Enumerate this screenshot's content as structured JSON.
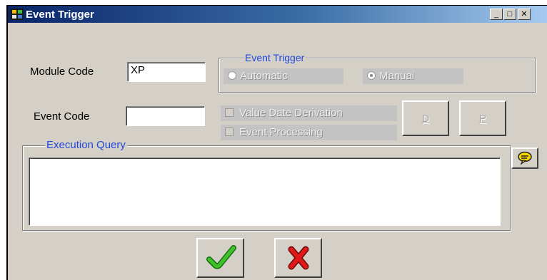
{
  "window": {
    "title": "Event Trigger",
    "controls": {
      "minimize": "_",
      "maximize": "□",
      "close": "✕"
    }
  },
  "form": {
    "module_code_label": "Module Code",
    "module_code_value": "XP",
    "event_code_label": "Event Code",
    "event_code_value": ""
  },
  "event_trigger_group": {
    "title": "Event Trigger",
    "options": [
      {
        "label": "Automatic",
        "selected": false
      },
      {
        "label": "Manual",
        "selected": true
      }
    ]
  },
  "checkboxes": [
    {
      "label": "Value Date Derivation",
      "checked": false
    },
    {
      "label": "Event Processing",
      "checked": false
    }
  ],
  "buttons": {
    "d_label": "D",
    "p_label": "P"
  },
  "execution_query": {
    "title": "Execution Query",
    "value": ""
  },
  "icons": {
    "app": "event-trigger-app-icon",
    "speech": "speech-bubble-icon",
    "ok": "green-checkmark-icon",
    "cancel": "red-x-icon"
  },
  "colors": {
    "titlebar_start": "#0a246a",
    "legend_text": "#2147d8",
    "ok": "#2a9d1a",
    "cancel": "#d01010"
  }
}
